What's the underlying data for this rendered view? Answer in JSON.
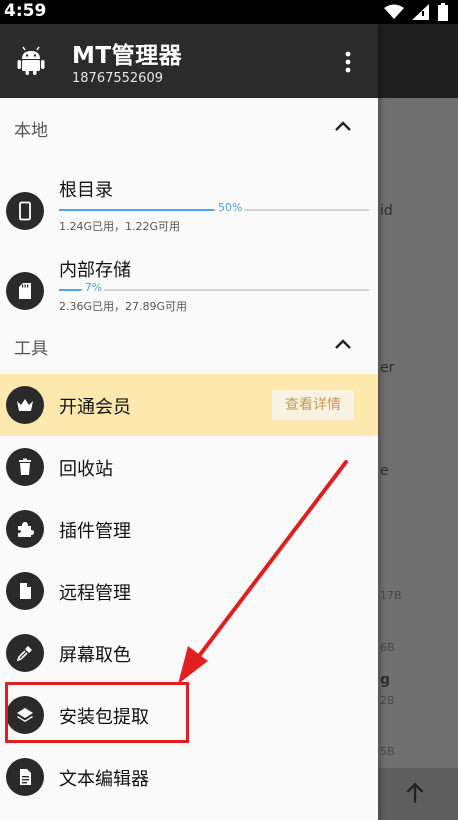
{
  "status_bar": {
    "time": "4:59"
  },
  "header": {
    "title": "MT管理器",
    "subtitle": "18767552609"
  },
  "sections": {
    "local": {
      "label": "本地"
    },
    "tools": {
      "label": "工具"
    }
  },
  "storage": [
    {
      "name": "根目录",
      "percent": 50,
      "percent_label": "50%",
      "usage": "1.24G已用，1.22G可用",
      "icon": "phone-icon"
    },
    {
      "name": "内部存储",
      "percent": 7,
      "percent_label": "7%",
      "usage": "2.36G已用，27.89G可用",
      "icon": "sd-card-icon"
    }
  ],
  "tools": [
    {
      "label": "开通会员",
      "icon": "crown-icon",
      "action": "查看详情"
    },
    {
      "label": "回收站",
      "icon": "trash-icon"
    },
    {
      "label": "插件管理",
      "icon": "puzzle-icon"
    },
    {
      "label": "远程管理",
      "icon": "file-icon"
    },
    {
      "label": "屏幕取色",
      "icon": "eyedropper-icon"
    },
    {
      "label": "安装包提取",
      "icon": "layers-icon"
    },
    {
      "label": "文本编辑器",
      "icon": "document-icon"
    }
  ],
  "background_fragments": {
    "f1": "id",
    "f2": "er",
    "f3": "e",
    "f4": "17B",
    "f5": "6B",
    "f6": "g",
    "f7": "2B",
    "f8": "5B"
  },
  "colors": {
    "accent": "#4aa3e8",
    "vip_bg": "#fde9ad",
    "highlight": "#e02020",
    "header_bg": "#2b2b2b"
  }
}
